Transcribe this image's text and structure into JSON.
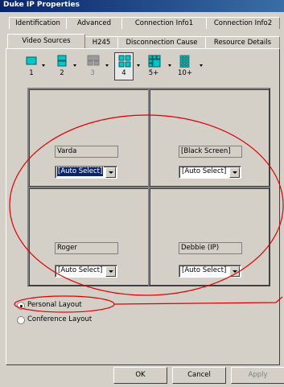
{
  "window": {
    "title": "Duke IP Properties"
  },
  "tabs_row1": [
    "Identification",
    "Advanced",
    "Connection Info1",
    "Connection Info2"
  ],
  "tabs_row2": [
    "Video Sources",
    "H245",
    "Disconnection Cause",
    "Resource Details"
  ],
  "active_tab": "Video Sources",
  "layout_buttons": [
    {
      "label": "1",
      "icon": "layout-1-icon"
    },
    {
      "label": "2",
      "icon": "layout-2-icon"
    },
    {
      "label": "3",
      "icon": "layout-3-icon",
      "state": "disabled"
    },
    {
      "label": "4",
      "icon": "layout-4-icon",
      "state": "selected"
    },
    {
      "label": "5+",
      "icon": "layout-5plus-icon"
    },
    {
      "label": "10+",
      "icon": "layout-10plus-icon"
    }
  ],
  "cells": [
    {
      "name": "Varda",
      "source": "[Auto Select]",
      "selected": true
    },
    {
      "name": "[Black Screen]",
      "source": "[Auto Select]"
    },
    {
      "name": "Roger",
      "source": "[Auto Select]"
    },
    {
      "name": "Debbie (IP)",
      "source": "[Auto Select]"
    }
  ],
  "layout_options": [
    {
      "label": "Personal Layout",
      "checked": true
    },
    {
      "label": "Conference Layout",
      "checked": false
    }
  ],
  "buttons": {
    "ok": "OK",
    "cancel": "Cancel",
    "apply": "Apply"
  },
  "colors": {
    "accent_icon": "#00c8c8",
    "annotation": "#e00000",
    "title_bar": "#0a246a"
  }
}
